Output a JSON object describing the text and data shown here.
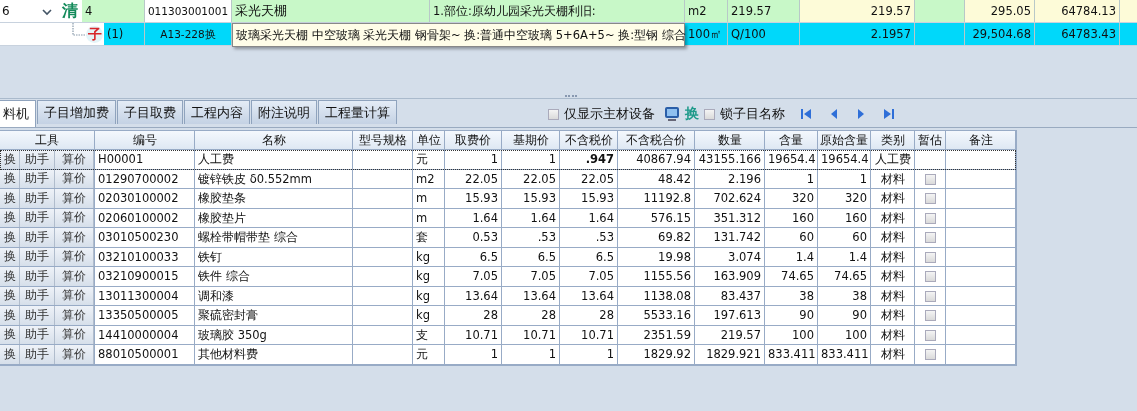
{
  "upper_grid": {
    "rows": [
      {
        "kind": "bill",
        "row_number": "6",
        "expanded": true,
        "type_label": "清",
        "index": "4",
        "code": "011303001001",
        "name": "采光天棚",
        "feature": "1.部位:原幼儿园采光天棚利旧:",
        "unit": "m2",
        "quantity_expression": "219.57",
        "quantity": "219.57",
        "unit_price": "295.05",
        "amount": "64784.13"
      },
      {
        "kind": "item",
        "type_label": "子",
        "index": "(1)",
        "code": "A13-228换",
        "name": "玻璃采光天棚 中空玻璃 采光天棚 钢骨架~ 换:普通中空玻璃 5+6A+5~ 换:型钢 综合",
        "unit": "100㎡",
        "quantity_expression": "Q/100",
        "quantity": "2.1957",
        "unit_price": "29,504.68",
        "amount": "64783.43"
      }
    ]
  },
  "tabs": [
    {
      "label": "料机",
      "selected": true
    },
    {
      "label": "子目增加费",
      "selected": false
    },
    {
      "label": "子目取费",
      "selected": false
    },
    {
      "label": "工程内容",
      "selected": false
    },
    {
      "label": "附注说明",
      "selected": false
    },
    {
      "label": "工程量计算",
      "selected": false
    }
  ],
  "toolbar": {
    "main_material_only": {
      "label": "仅显示主材设备",
      "checked": false
    },
    "replace_label": "换",
    "lock_name": {
      "label": "锁子目名称",
      "checked": false
    }
  },
  "table": {
    "columns": [
      "工具",
      "编号",
      "名称",
      "型号规格",
      "单位",
      "取费价",
      "基期价",
      "不含税价",
      "不含税合价",
      "数量",
      "含量",
      "原始含量",
      "类别",
      "暂估",
      "备注"
    ],
    "rows": [
      {
        "focused": true,
        "tools": [
          "换",
          "助手",
          "算价"
        ],
        "code": "H00001",
        "name": "人工费",
        "spec": "",
        "unit": "元",
        "fee_price": "1",
        "base_price": "1",
        "excl_tax_price": ".947",
        "excl_tax_total": "40867.94",
        "quantity": "43155.166",
        "content": "19654.4",
        "original_content": "19654.4",
        "category": "人工费"
      },
      {
        "focused": false,
        "tools": [
          "换",
          "助手",
          "算价"
        ],
        "code": "01290700002",
        "name": "镀锌铁皮 δ0.552mm",
        "unit": "m2",
        "fee_price": "22.05",
        "base_price": "22.05",
        "excl_tax_price": "22.05",
        "excl_tax_total": "48.42",
        "quantity": "2.196",
        "content": "1",
        "original_content": "1",
        "category": "材料",
        "provisional": false
      },
      {
        "focused": false,
        "tools": [
          "换",
          "助手",
          "算价"
        ],
        "code": "02030100002",
        "name": "橡胶垫条",
        "unit": "m",
        "fee_price": "15.93",
        "base_price": "15.93",
        "excl_tax_price": "15.93",
        "excl_tax_total": "11192.8",
        "quantity": "702.624",
        "content": "320",
        "original_content": "320",
        "category": "材料",
        "provisional": false
      },
      {
        "focused": false,
        "tools": [
          "换",
          "助手",
          "算价"
        ],
        "code": "02060100002",
        "name": "橡胶垫片",
        "unit": "m",
        "fee_price": "1.64",
        "base_price": "1.64",
        "excl_tax_price": "1.64",
        "excl_tax_total": "576.15",
        "quantity": "351.312",
        "content": "160",
        "original_content": "160",
        "category": "材料",
        "provisional": false
      },
      {
        "focused": false,
        "tools": [
          "换",
          "助手",
          "算价"
        ],
        "code": "03010500230",
        "name": "螺栓带帽带垫 综合",
        "unit": "套",
        "fee_price": "0.53",
        "base_price": ".53",
        "excl_tax_price": ".53",
        "excl_tax_total": "69.82",
        "quantity": "131.742",
        "content": "60",
        "original_content": "60",
        "category": "材料",
        "provisional": false
      },
      {
        "focused": false,
        "tools": [
          "换",
          "助手",
          "算价"
        ],
        "code": "03210100033",
        "name": "铁钉",
        "unit": "kg",
        "fee_price": "6.5",
        "base_price": "6.5",
        "excl_tax_price": "6.5",
        "excl_tax_total": "19.98",
        "quantity": "3.074",
        "content": "1.4",
        "original_content": "1.4",
        "category": "材料",
        "provisional": false
      },
      {
        "focused": false,
        "tools": [
          "换",
          "助手",
          "算价"
        ],
        "code": "03210900015",
        "name": "铁件 综合",
        "unit": "kg",
        "fee_price": "7.05",
        "base_price": "7.05",
        "excl_tax_price": "7.05",
        "excl_tax_total": "1155.56",
        "quantity": "163.909",
        "content": "74.65",
        "original_content": "74.65",
        "category": "材料",
        "provisional": false
      },
      {
        "focused": false,
        "tools": [
          "换",
          "助手",
          "算价"
        ],
        "code": "13011300004",
        "name": "调和漆",
        "unit": "kg",
        "fee_price": "13.64",
        "base_price": "13.64",
        "excl_tax_price": "13.64",
        "excl_tax_total": "1138.08",
        "quantity": "83.437",
        "content": "38",
        "original_content": "38",
        "category": "材料",
        "provisional": false
      },
      {
        "focused": false,
        "tools": [
          "换",
          "助手",
          "算价"
        ],
        "code": "13350500005",
        "name": "聚硫密封膏",
        "unit": "kg",
        "fee_price": "28",
        "base_price": "28",
        "excl_tax_price": "28",
        "excl_tax_total": "5533.16",
        "quantity": "197.613",
        "content": "90",
        "original_content": "90",
        "category": "材料",
        "provisional": false
      },
      {
        "focused": false,
        "tools": [
          "换",
          "助手",
          "算价"
        ],
        "code": "14410000004",
        "name": "玻璃胶 350g",
        "unit": "支",
        "fee_price": "10.71",
        "base_price": "10.71",
        "excl_tax_price": "10.71",
        "excl_tax_total": "2351.59",
        "quantity": "219.57",
        "content": "100",
        "original_content": "100",
        "category": "材料",
        "provisional": false
      },
      {
        "focused": false,
        "tools": [
          "换",
          "助手",
          "算价"
        ],
        "code": "88010500001",
        "name": "其他材料费",
        "unit": "元",
        "fee_price": "1",
        "base_price": "1",
        "excl_tax_price": "1",
        "excl_tax_total": "1829.92",
        "quantity": "1829.921",
        "content": "833.411",
        "original_content": "833.411",
        "category": "材料",
        "provisional": false
      }
    ]
  }
}
